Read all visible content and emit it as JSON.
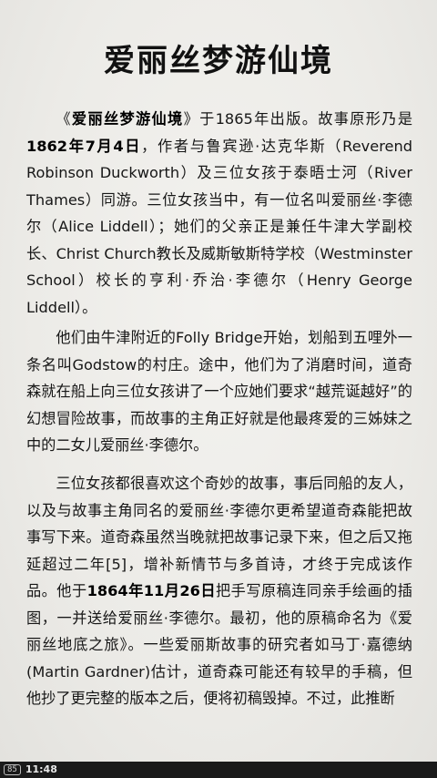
{
  "title": "爱丽丝梦游仙境",
  "paragraphs": {
    "p1": {
      "s1": "《",
      "book_title": "爱丽丝梦游仙境",
      "s2": "》于1865年出版。故事原形乃是",
      "date": "1862年7月4日",
      "s3": "，作者与鲁宾逊·达克华斯（Reverend Robinson Duckworth）及三位女孩于泰晤士河（River Thames）同游。三位女孩当中，有一位名叫爱丽丝·李德尔（Alice Liddell）；她们的父亲正是兼任牛津大学副校长、Christ Church教长及威斯敏斯特学校（Westminster School）校长的亨利·乔治·李德尔（Henry George Liddell）。"
    },
    "p2": {
      "text": "他们由牛津附近的Folly Bridge开始，划船到五哩外一条名叫Godstow的村庄。途中，他们为了消磨时间，道奇森就在船上向三位女孩讲了一个应她们要求“越荒诞越好”的幻想冒险故事，而故事的主角正好就是他最疼爱的三姊妹之中的二女儿爱丽丝·李德尔。"
    },
    "p3": {
      "s1": "三位女孩都很喜欢这个奇妙的故事，事后同船的友人，以及与故事主角同名的爱丽丝·李德尔更希望道奇森能把故事写下来。道奇森虽然当晚就把故事记录下来，但之后又拖延超过二年[5]，增补新情节与多首诗，才终于完成该作品。他于",
      "date": "1864年11月26日",
      "s2": "把手写原稿连同亲手绘画的插图，一并送给爱丽丝·李德尔。最初，他的原稿命名为《爱丽丝地底之旅》。一些爱丽斯故事的研究者如马丁·嘉德纳(Martin Gardner)估计，道奇森可能还有较早的手稿，但他抄了更完整的版本之后，便将初稿毁掉。不过，此推断"
    }
  },
  "status_bar": {
    "battery": "85",
    "time": "11:48"
  }
}
